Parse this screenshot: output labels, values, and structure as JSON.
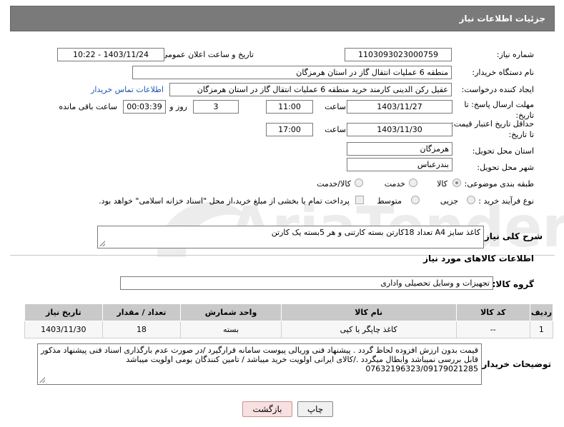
{
  "header": {
    "title": "جزئیات اطلاعات نیاز"
  },
  "form": {
    "need_number_label": "شماره نیاز:",
    "need_number": "1103093023000759",
    "announce_label": "تاریخ و ساعت اعلان عمومی:",
    "announce_value": "1403/11/24 - 10:22",
    "buyer_label": "نام دستگاه خریدار:",
    "buyer_value": "منطقه 6 عملیات انتقال گاز در استان هرمزگان",
    "creator_label": "ایجاد کننده درخواست:",
    "creator_value": "عقیل رکن الدینی کارمند خرید منطقه 6 عملیات انتقال گاز در استان هرمزگان",
    "contact_link": "اطلاعات تماس خریدار",
    "deadline_label": "مهلت ارسال پاسخ: تا تاریخ:",
    "deadline_date": "1403/11/27",
    "time_label": "ساعت",
    "deadline_time": "11:00",
    "days_value": "3",
    "days_label": "روز و",
    "remaining_time": "00:03:39",
    "remaining_label": "ساعت باقی مانده",
    "validity_label": "حداقل تاریخ اعتبار قیمت: تا تاریخ:",
    "validity_date": "1403/11/30",
    "validity_time": "17:00",
    "province_label": "استان محل تحویل:",
    "province_value": "هرمزگان",
    "city_label": "شهر محل تحویل:",
    "city_value": "بندرعباس",
    "category_label": "طبقه بندی موضوعی:",
    "category_options": [
      "کالا",
      "خدمت",
      "کالا/خدمت"
    ],
    "process_label": "نوع فرآیند خرید :",
    "process_options": [
      "جزیی",
      "متوسط"
    ],
    "payment_note": "پرداخت تمام یا بخشی از مبلغ خرید،از محل \"اسناد خزانه اسلامی\" خواهد بود.",
    "description_label": "شرح کلی نیاز:",
    "description_value": "کاغذ سایز A4 تعداد 18کارتن  بسته کارتنی و هر 5بسته یک کارتن",
    "goods_info_title": "اطلاعات کالاهای مورد نیاز",
    "goods_group_label": "گروه کالا:",
    "goods_group_value": "تجهیزات و وسایل تحصیلی واداری"
  },
  "table": {
    "headers": [
      "ردیف",
      "کد کالا",
      "نام کالا",
      "واحد شمارش",
      "تعداد / مقدار",
      "تاریخ نیاز"
    ],
    "rows": [
      [
        "1",
        "--",
        "کاغذ چاپگر یا کپی",
        "بسته",
        "18",
        "1403/11/30"
      ]
    ]
  },
  "notes": {
    "label": "توضیحات خریدار:",
    "value": "قیمت بدون ارزش افزوده لحاظ گردد . پیشنهاد فنی وریالی پیوست سامانه قرارگیرد /در صورت عدم بارگذاری اسناد فنی پیشنهاد مذکور قابل بررسی نمیباشد وابطال میگردد ./کالای ایرانی اولویت خرید میباشد / تامین کنندگان بومی اولویت میباشد 07632196323/09179021285"
  },
  "buttons": {
    "print": "چاپ",
    "back": "بازگشت"
  },
  "watermark": {
    "text": "AriaTender.neT"
  },
  "colors": {
    "header_bg": "#7a7a7a",
    "link": "#1a55b5",
    "back_btn": "#f8e0e0",
    "table_header": "#c9c9c9"
  }
}
